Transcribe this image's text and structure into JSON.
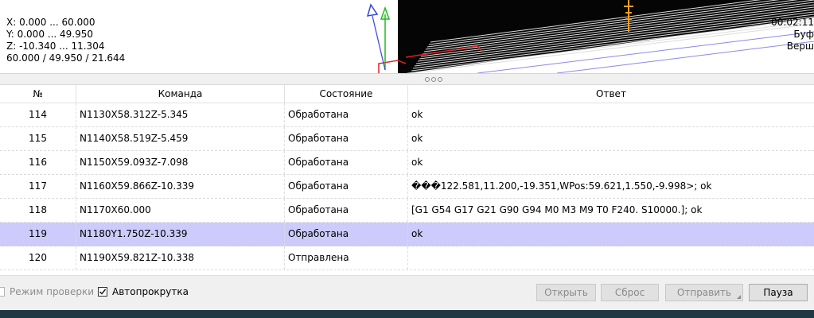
{
  "viewport": {
    "info_left": [
      "X: 0.000 ... 60.000",
      "Y: 0.000 ... 49.950",
      "Z: -10.340 ... 11.304",
      "60.000 / 49.950 / 21.644"
    ],
    "info_right": [
      "00:02:11",
      "Буф",
      "Верш"
    ]
  },
  "table": {
    "headers": [
      "№",
      "Команда",
      "Состояние",
      "Ответ"
    ],
    "rows": [
      {
        "num": "114",
        "command": "N1130X58.312Z-5.345",
        "state": "Обработана",
        "response": "ok"
      },
      {
        "num": "115",
        "command": "N1140X58.519Z-5.459",
        "state": "Обработана",
        "response": "ok"
      },
      {
        "num": "116",
        "command": "N1150X59.093Z-7.098",
        "state": "Обработана",
        "response": "ok"
      },
      {
        "num": "117",
        "command": "N1160X59.866Z-10.339",
        "state": "Обработана",
        "response": "���122.581,11.200,-19.351,WPos:59.621,1.550,-9.998>; ok"
      },
      {
        "num": "118",
        "command": "N1170X60.000",
        "state": "Обработана",
        "response": "[G1 G54 G17 G21 G90 G94 M0 M3 M9 T0 F240. S10000.]; ok"
      },
      {
        "num": "119",
        "command": "N1180Y1.750Z-10.339",
        "state": "Обработана",
        "response": "ok",
        "selected": true
      },
      {
        "num": "120",
        "command": "N1190X59.821Z-10.338",
        "state": "Отправлена",
        "response": ""
      }
    ]
  },
  "controls": {
    "check_mode_label": "Режим проверки",
    "autoscroll_label": "Автопрокрутка",
    "open_label": "Открыть",
    "reset_label": "Сброс",
    "send_label": "Отправить",
    "pause_label": "Пауза"
  },
  "colors": {
    "selected_row": "#cccbfb",
    "status_strip": "#203844",
    "axis_y": "#22bb22",
    "axis_z": "#3344dd",
    "tool": "#f0a020",
    "bounds": "#dd2222"
  }
}
